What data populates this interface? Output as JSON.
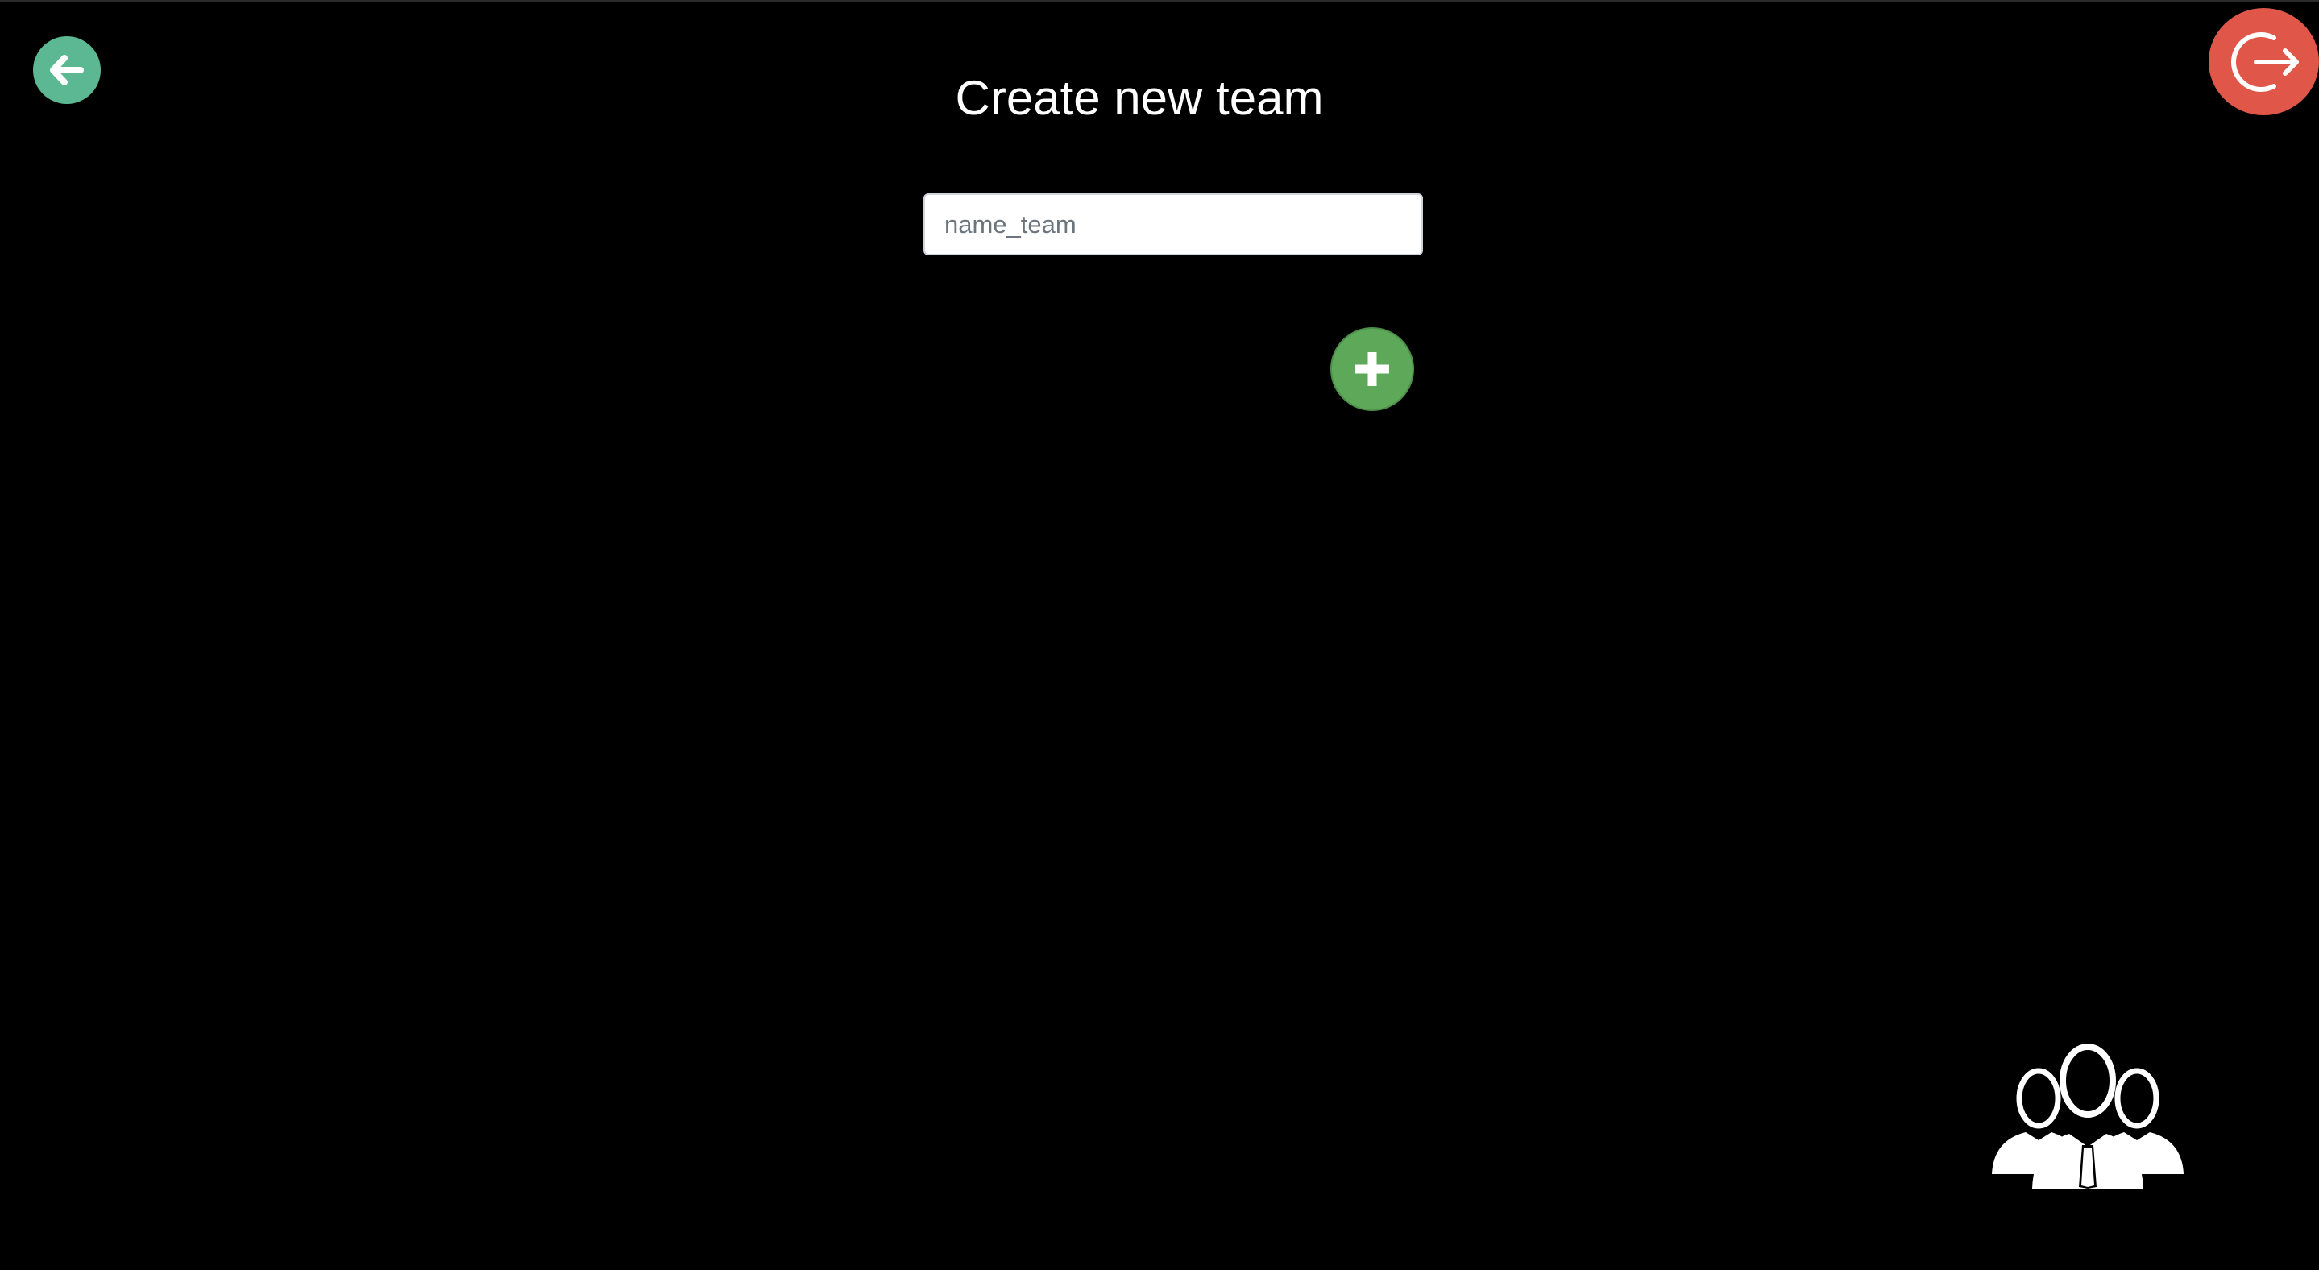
{
  "header": {
    "title": "Create new team"
  },
  "form": {
    "name_placeholder": "name_team",
    "name_value": ""
  },
  "icons": {
    "back": "arrow-left-icon",
    "logout": "sign-out-icon",
    "add": "plus-icon",
    "team": "team-users-icon"
  },
  "colors": {
    "background": "#000000",
    "back_button": "#5cb892",
    "logout_button": "#e0574a",
    "add_button": "#5ea85a",
    "title_text": "#ffffff"
  }
}
